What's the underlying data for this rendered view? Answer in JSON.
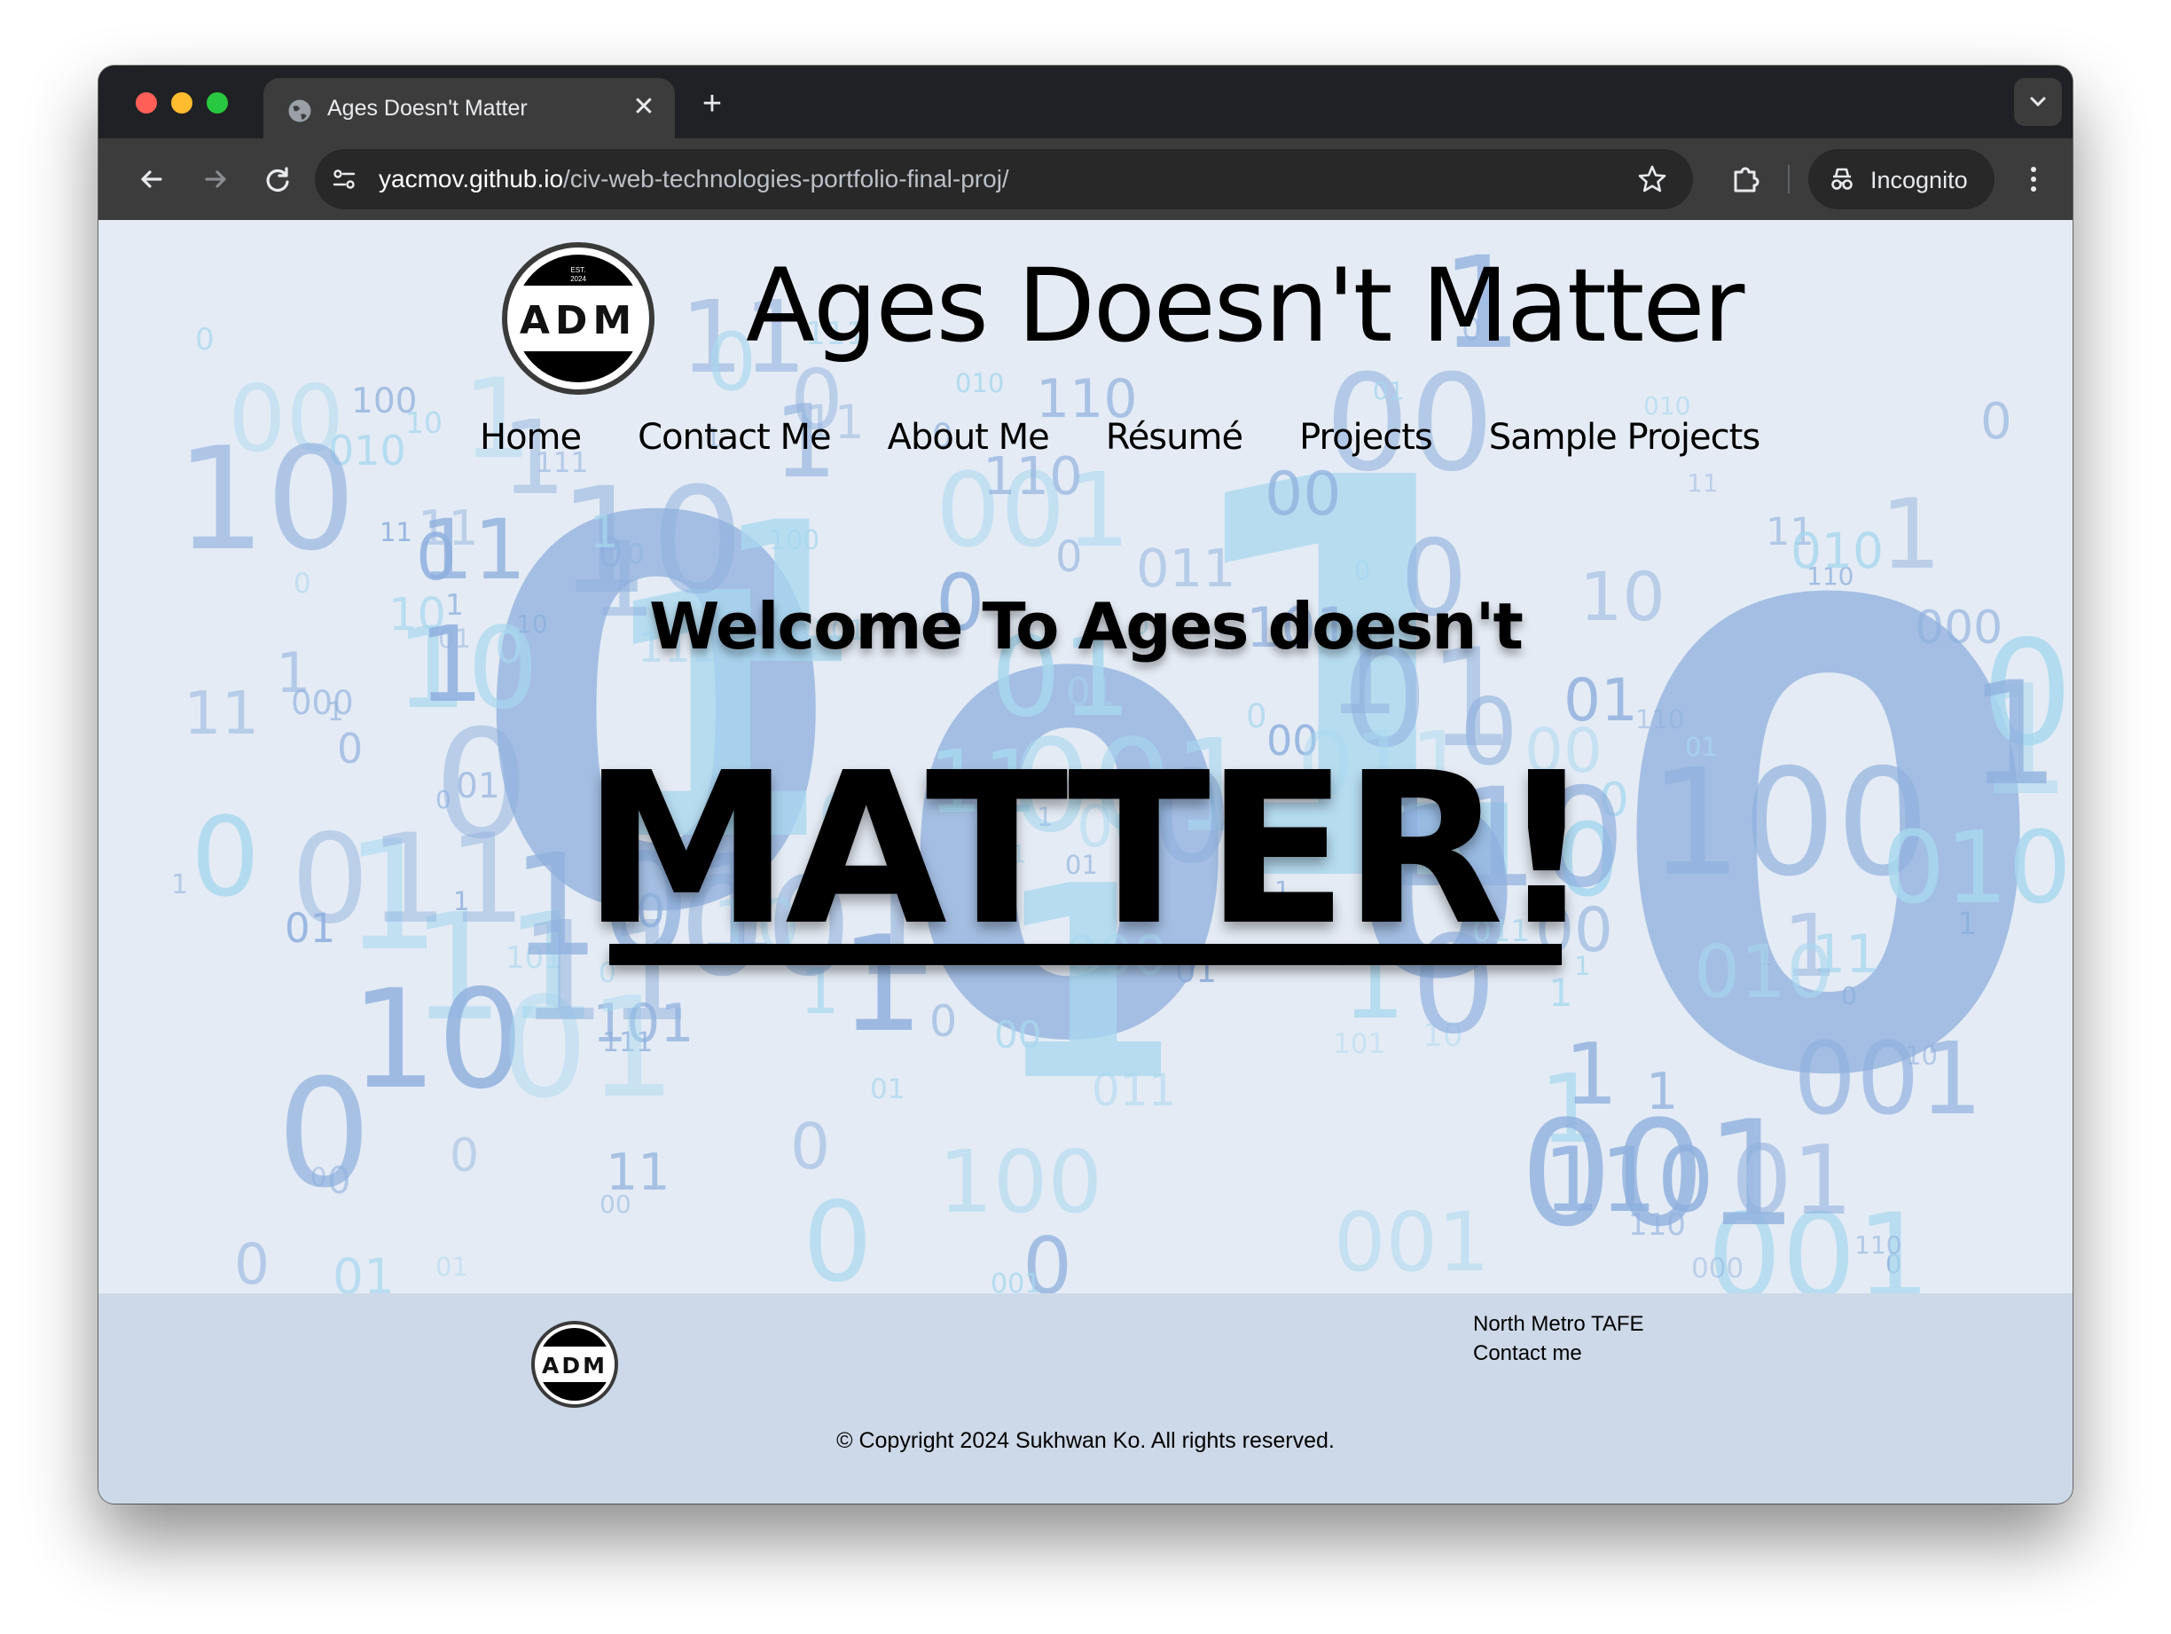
{
  "browser": {
    "tab_title": "Ages Doesn't Matter",
    "new_tab_label": "+",
    "close_tab_label": "✕",
    "url_domain": "yacmov.github.io",
    "url_path": "/civ-web-technologies-portfolio-final-proj/",
    "incognito_label": "Incognito"
  },
  "site": {
    "logo_text": "ADM",
    "logo_est": "EST.",
    "logo_year": "2024",
    "title": "Ages Doesn't Matter",
    "nav": [
      "Home",
      "Contact Me",
      "About Me",
      "Résumé",
      "Projects",
      "Sample Projects"
    ],
    "welcome": "Welcome To Ages doesn't",
    "headline": "MATTER!"
  },
  "footer": {
    "links": [
      "North Metro TAFE",
      "Contact me"
    ],
    "copyright": "© Copyright 2024 Sukhwan Ko. All rights reserved."
  },
  "colors": {
    "page_bg": "#e4ebf4",
    "footer_bg": "#cdd9e8",
    "digit_blue": "#8fb0de",
    "digit_cyan": "#a8d8ef"
  }
}
